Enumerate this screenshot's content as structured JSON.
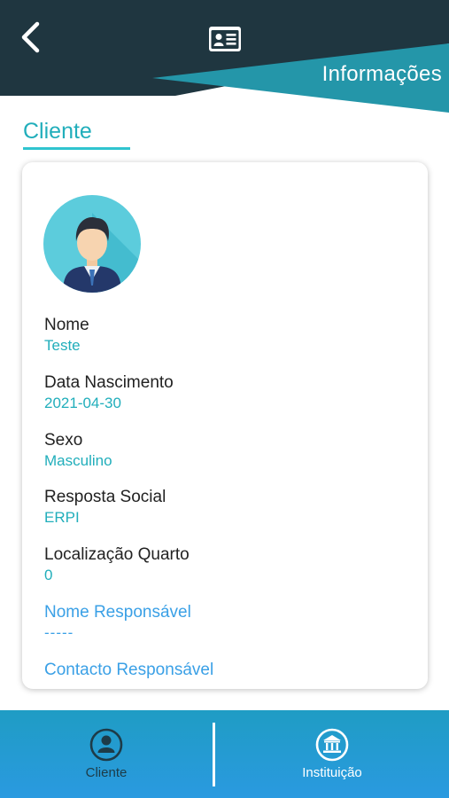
{
  "header": {
    "title": "Informações",
    "colors": {
      "dark": "#1f3640",
      "accent": "#2496a9"
    },
    "icons": {
      "back": "back-arrow-icon",
      "center": "id-card-icon"
    }
  },
  "section": {
    "title": "Cliente"
  },
  "client": {
    "avatar": "user-avatar-icon",
    "fields": [
      {
        "label": "Nome",
        "value": "Teste"
      },
      {
        "label": "Data Nascimento",
        "value": "2021-04-30"
      },
      {
        "label": "Sexo",
        "value": "Masculino"
      },
      {
        "label": "Resposta Social",
        "value": "ERPI"
      },
      {
        "label": "Localização Quarto",
        "value": "0"
      },
      {
        "label": "Nome Responsável",
        "value": "-----"
      },
      {
        "label": "Contacto Responsável",
        "value": ""
      }
    ]
  },
  "nav": {
    "items": [
      {
        "label": "Cliente",
        "icon": "user-circle-icon",
        "active": true
      },
      {
        "label": "Instituição",
        "icon": "institution-icon",
        "active": false
      }
    ],
    "colors": {
      "active_text": "#1d3b48",
      "inactive_text": "#ffffff"
    }
  }
}
